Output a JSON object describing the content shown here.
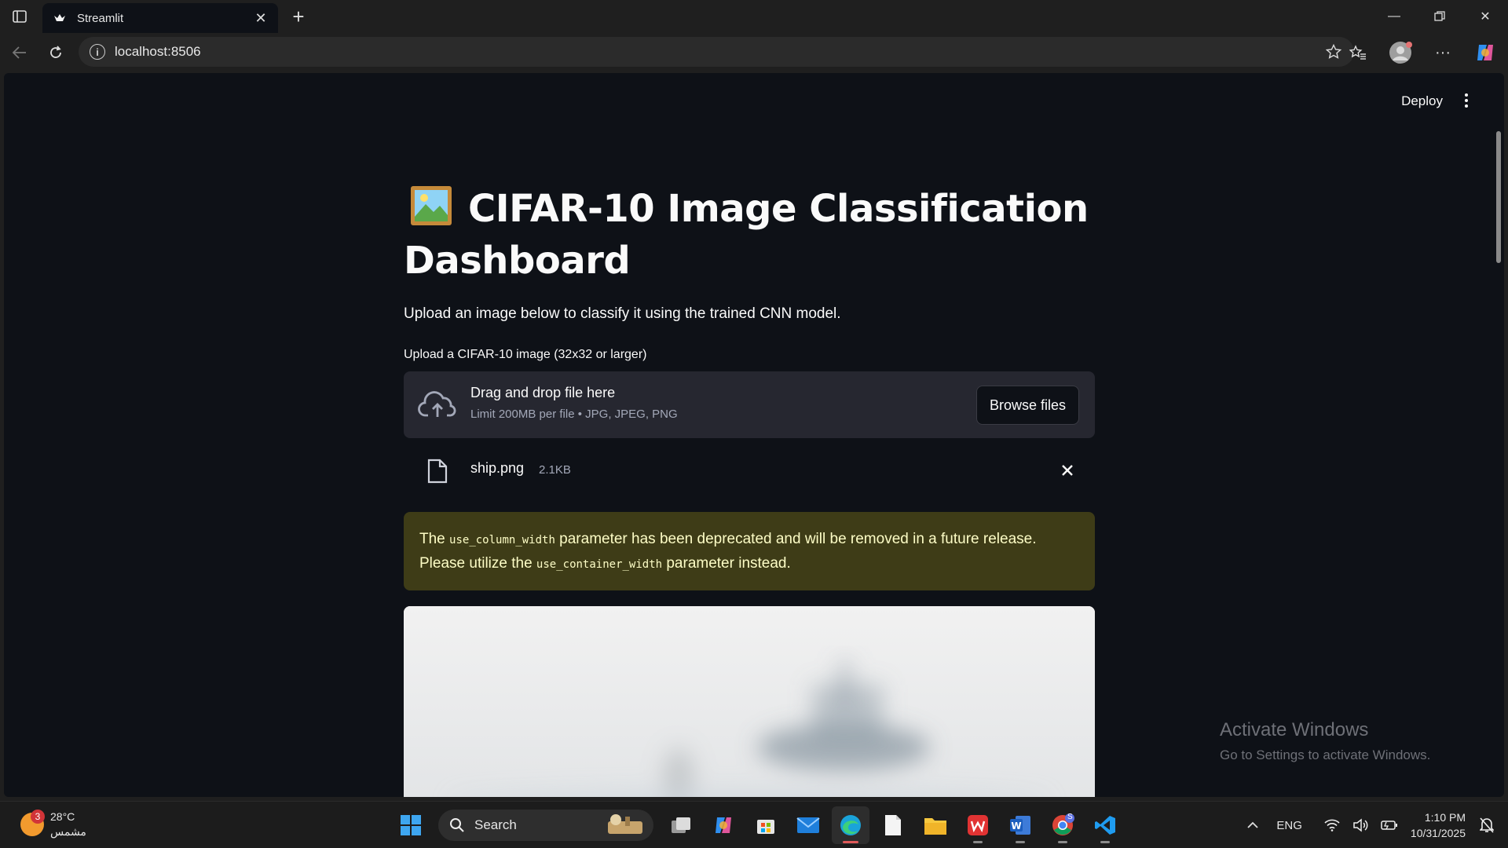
{
  "browser": {
    "tab_title": "Streamlit",
    "url": "localhost:8506"
  },
  "app": {
    "deploy_label": "Deploy",
    "title_line1": "CIFAR-10 Image Classification",
    "title_line2": "Dashboard",
    "subtitle": "Upload an image below to classify it using the trained CNN model.",
    "uploader_label": "Upload a CIFAR-10 image (32x32 or larger)",
    "dropzone_main": "Drag and drop file here",
    "dropzone_sub": "Limit 200MB per file • JPG, JPEG, PNG",
    "browse_label": "Browse files",
    "file_name": "ship.png",
    "file_size": "2.1KB",
    "warning": {
      "p1": "The ",
      "code1": "use_column_width",
      "p2": " parameter has been deprecated and will be removed in a future release. Please utilize the ",
      "code2": "use_container_width",
      "p3": " parameter instead."
    }
  },
  "watermark": {
    "line1": "Activate Windows",
    "line2": "Go to Settings to activate Windows."
  },
  "taskbar": {
    "weather_temp": "28°C",
    "weather_desc": "مشمس",
    "weather_badge": "3",
    "search_placeholder": "Search",
    "lang": "ENG",
    "time": "1:10 PM",
    "date": "10/31/2025",
    "chrome_badge": "S"
  },
  "colors": {
    "app_bg": "#0e1117",
    "card_bg": "#262730",
    "warning_bg": "#3e3c17",
    "warning_text": "#fdfdc6"
  }
}
